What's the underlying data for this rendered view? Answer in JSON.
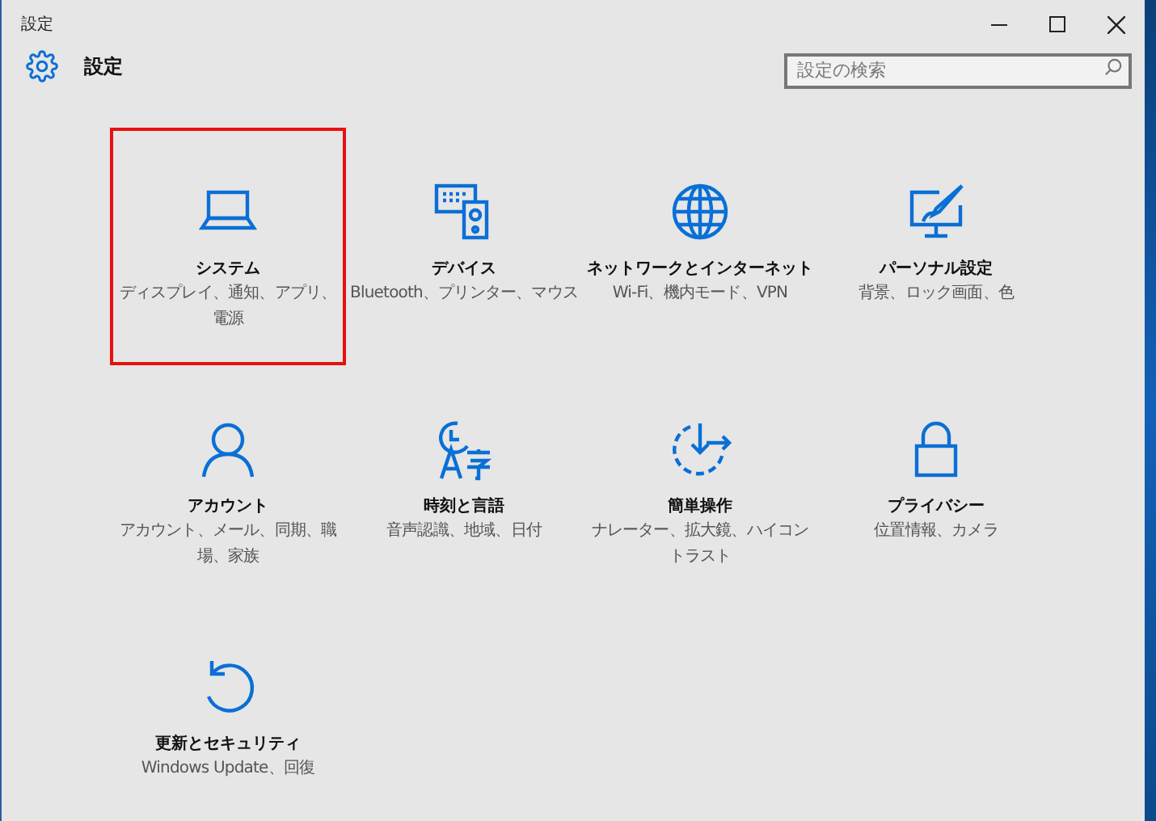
{
  "window": {
    "title": "設定"
  },
  "header": {
    "title": "設定"
  },
  "search": {
    "placeholder": "設定の検索"
  },
  "tiles": [
    {
      "title": "システム",
      "subtitle": "ディスプレイ、通知、アプリ、電源",
      "highlighted": true
    },
    {
      "title": "デバイス",
      "subtitle": "Bluetooth、プリンター、マウス",
      "highlighted": false
    },
    {
      "title": "ネットワークとインターネット",
      "subtitle": "Wi-Fi、機内モード、VPN",
      "highlighted": false
    },
    {
      "title": "パーソナル設定",
      "subtitle": "背景、ロック画面、色",
      "highlighted": false
    },
    {
      "title": "アカウント",
      "subtitle": "アカウント、メール、同期、職場、家族",
      "highlighted": false
    },
    {
      "title": "時刻と言語",
      "subtitle": "音声認識、地域、日付",
      "highlighted": false
    },
    {
      "title": "簡単操作",
      "subtitle": "ナレーター、拡大鏡、ハイコントラスト",
      "highlighted": false
    },
    {
      "title": "プライバシー",
      "subtitle": "位置情報、カメラ",
      "highlighted": false
    },
    {
      "title": "更新とセキュリティ",
      "subtitle": "Windows Update、回復",
      "highlighted": false
    }
  ]
}
